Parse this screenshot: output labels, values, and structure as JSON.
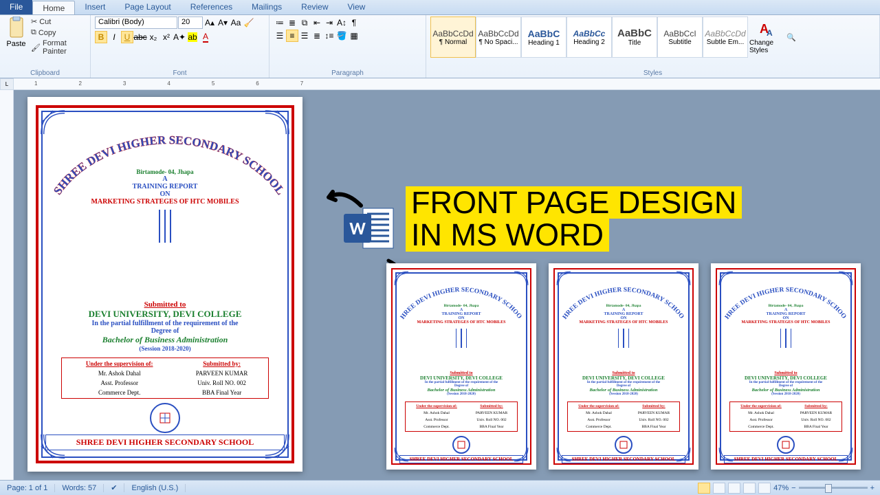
{
  "tabs": {
    "file": "File",
    "home": "Home",
    "insert": "Insert",
    "pageLayout": "Page Layout",
    "references": "References",
    "mailings": "Mailings",
    "review": "Review",
    "view": "View"
  },
  "clipboard": {
    "paste": "Paste",
    "cut": "Cut",
    "copy": "Copy",
    "formatPainter": "Format Painter",
    "label": "Clipboard"
  },
  "font": {
    "name": "Calibri (Body)",
    "size": "20",
    "label": "Font"
  },
  "paragraph": {
    "label": "Paragraph"
  },
  "styles": {
    "label": "Styles",
    "tiles": [
      {
        "preview": "AaBbCcDd",
        "name": "¶ Normal"
      },
      {
        "preview": "AaBbCcDd",
        "name": "¶ No Spaci..."
      },
      {
        "preview": "AaBbC",
        "name": "Heading 1"
      },
      {
        "preview": "AaBbCc",
        "name": "Heading 2"
      },
      {
        "preview": "AaBbC",
        "name": "Title"
      },
      {
        "preview": "AaBbCcI",
        "name": "Subtitle"
      },
      {
        "preview": "AaBbCcDd",
        "name": "Subtle Em..."
      }
    ],
    "changeStyles": "Change Styles"
  },
  "ruler": [
    "1",
    "2",
    "3",
    "4",
    "5",
    "6",
    "7"
  ],
  "doc": {
    "arch": "SHREE DEVI HIGHER SECONDARY SCHOOL",
    "place": "Birtamode- 04, Jhapa",
    "a": "A",
    "training": "TRAINING REPORT",
    "on": "ON",
    "marketing": "MARKETING STRATEGES OF HTC MOBILES",
    "submitted": "Submitted to",
    "university": "DEVI UNIVERSITY, DEVI COLLEGE",
    "partial": "In the partial fulfillment of the requirement of the",
    "degree": "Degree of",
    "bba": "Bachelor of Business Administration",
    "session": "(Session 2018-2020)",
    "supervision": {
      "headL": "Under the supervision of:",
      "headR": "Submitted by:",
      "l1": "Mr. Ashok Dahal",
      "r1": "PARVEEN KUMAR",
      "l2": "Asst. Professor",
      "r2": "Univ. Roll NO. 002",
      "l3": "Commerce Dept.",
      "r3": "BBA Final Year"
    },
    "footer": "SHREE DEVI HIGHER SECONDARY SCHOOL"
  },
  "headline": {
    "l1": "FRONT PAGE DESIGN",
    "l2": "IN MS WORD"
  },
  "status": {
    "page": "Page: 1 of 1",
    "words": "Words: 57",
    "lang": "English (U.S.)",
    "zoom": "47%"
  }
}
